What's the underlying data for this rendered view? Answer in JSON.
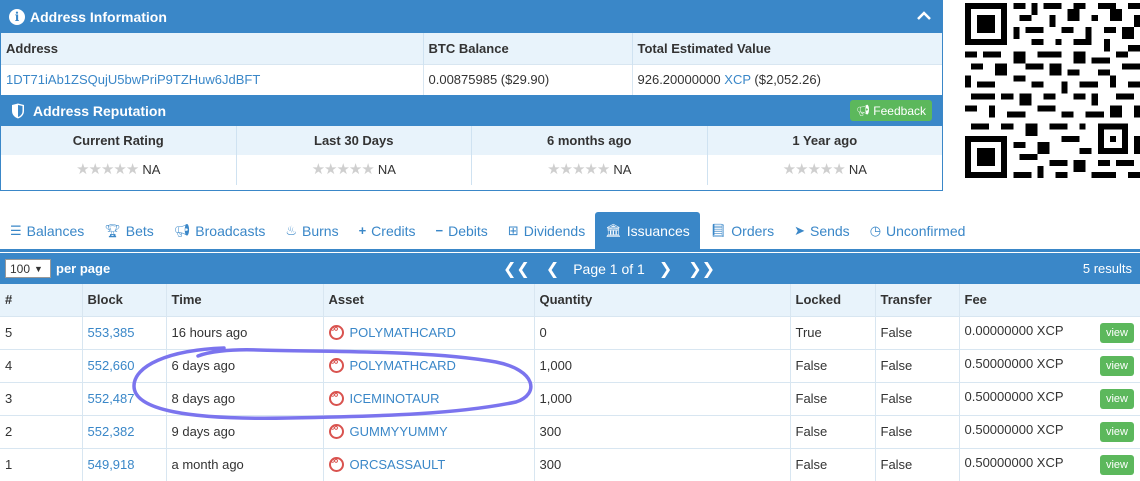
{
  "address_info": {
    "title": "Address Information",
    "columns": [
      "Address",
      "BTC Balance",
      "Total Estimated Value"
    ],
    "address": "1DT71iAb1ZSQujU5bwPriP9TZHuw6JdBFT",
    "btc_balance": "0.00875985 ($29.90)",
    "total_value_amount": "926.20000000",
    "total_value_unit": "XCP",
    "total_value_usd": "($2,052.26)"
  },
  "reputation": {
    "title": "Address Reputation",
    "feedback_label": "Feedback",
    "cells": [
      {
        "label": "Current Rating",
        "value": "NA"
      },
      {
        "label": "Last 30 Days",
        "value": "NA"
      },
      {
        "label": "6 months ago",
        "value": "NA"
      },
      {
        "label": "1 Year ago",
        "value": "NA"
      }
    ]
  },
  "tabs": [
    {
      "label": "Balances",
      "icon": "list-icon"
    },
    {
      "label": "Bets",
      "icon": "trophy-icon"
    },
    {
      "label": "Broadcasts",
      "icon": "bullhorn-icon"
    },
    {
      "label": "Burns",
      "icon": "fire-icon"
    },
    {
      "label": "Credits",
      "icon": "plus-icon"
    },
    {
      "label": "Debits",
      "icon": "minus-icon"
    },
    {
      "label": "Dividends",
      "icon": "sitemap-icon"
    },
    {
      "label": "Issuances",
      "icon": "bank-icon"
    },
    {
      "label": "Orders",
      "icon": "book-icon"
    },
    {
      "label": "Sends",
      "icon": "send-icon"
    },
    {
      "label": "Unconfirmed",
      "icon": "clock-icon"
    }
  ],
  "active_tab": "Issuances",
  "toolbar": {
    "per_page_value": "100",
    "per_page_label": "per page",
    "page_label": "Page 1 of 1",
    "results_label": "5 results"
  },
  "table": {
    "headers": [
      "#",
      "Block",
      "Time",
      "Asset",
      "Quantity",
      "Locked",
      "Transfer",
      "Fee"
    ],
    "view_label": "view",
    "rows": [
      {
        "num": "5",
        "block": "553,385",
        "time": "16 hours ago",
        "asset": "POLYMATHCARD",
        "quantity": "0",
        "locked": "True",
        "transfer": "False",
        "fee": "0.00000000 XCP"
      },
      {
        "num": "4",
        "block": "552,660",
        "time": "6 days ago",
        "asset": "POLYMATHCARD",
        "quantity": "1,000",
        "locked": "False",
        "transfer": "False",
        "fee": "0.50000000 XCP"
      },
      {
        "num": "3",
        "block": "552,487",
        "time": "8 days ago",
        "asset": "ICEMINOTAUR",
        "quantity": "1,000",
        "locked": "False",
        "transfer": "False",
        "fee": "0.50000000 XCP"
      },
      {
        "num": "2",
        "block": "552,382",
        "time": "9 days ago",
        "asset": "GUMMYYUMMY",
        "quantity": "300",
        "locked": "False",
        "transfer": "False",
        "fee": "0.50000000 XCP"
      },
      {
        "num": "1",
        "block": "549,918",
        "time": "a month ago",
        "asset": "ORCSASSAULT",
        "quantity": "300",
        "locked": "False",
        "transfer": "False",
        "fee": "0.50000000 XCP"
      }
    ]
  },
  "colors": {
    "primary": "#3a87c8",
    "header_bg": "#e8f3fb",
    "success": "#5cb85c",
    "asset_icon": "#d9534f",
    "annotation": "#7b74ee"
  }
}
